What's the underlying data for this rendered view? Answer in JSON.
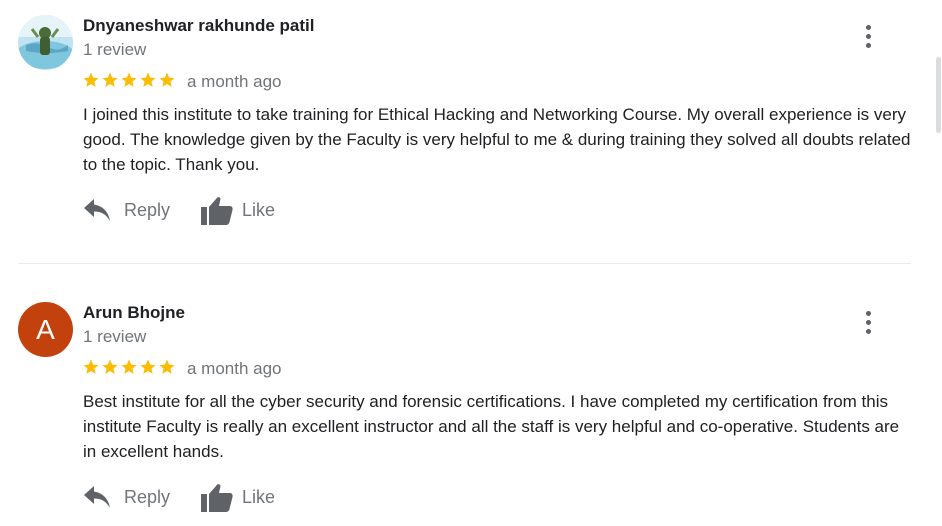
{
  "reviews": [
    {
      "name": "Dnyaneshwar rakhunde patil",
      "review_count": "1 review",
      "rating": 5,
      "time": "a month ago",
      "text": "I joined this institute to take training for Ethical Hacking and Networking Course. My overall experience is very good. The knowledge given by the Faculty is very helpful to me & during training they solved all doubts related to the topic. Thank you.",
      "avatar": "photo"
    },
    {
      "name": "Arun Bhojne",
      "review_count": "1 review",
      "rating": 5,
      "time": "a month ago",
      "text": "Best institute for all the cyber security and forensic certifications. I have completed my certification from this institute Faculty is really an excellent instructor and all the staff is very helpful and co-operative. Students are in excellent hands.",
      "avatar": "A",
      "avatar_color": "#c3410c"
    }
  ],
  "actions": {
    "reply_label": "Reply",
    "like_label": "Like"
  },
  "colors": {
    "star": "#fbbc04",
    "secondary_text": "#70757a",
    "icon": "#5f6368"
  }
}
